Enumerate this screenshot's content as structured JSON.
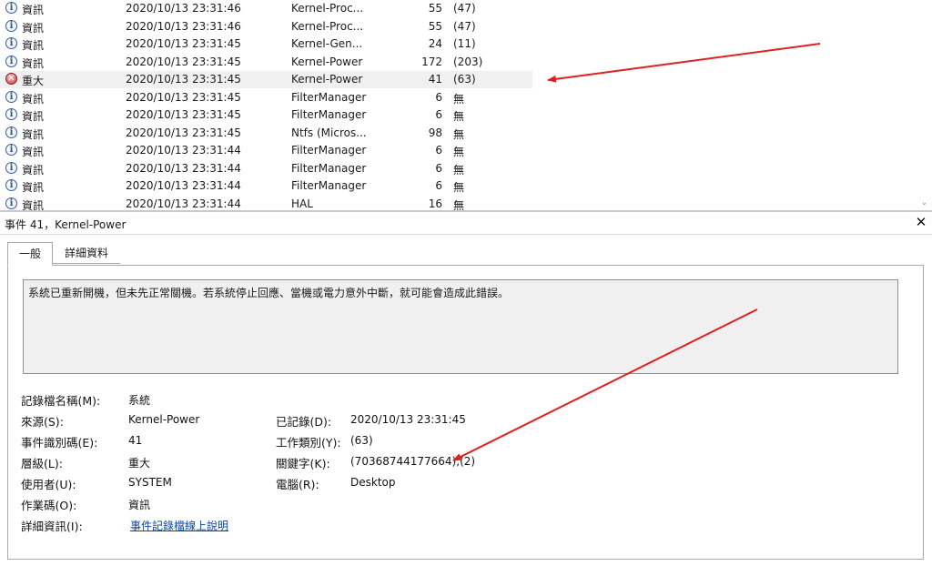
{
  "event_list": {
    "rows": [
      {
        "level": "資訊",
        "level_icon": "info-icon",
        "date": "2020/10/13 23:31:46",
        "source": "Kernel-Proc...",
        "event_id": "55",
        "task": "(47)",
        "selected": false
      },
      {
        "level": "資訊",
        "level_icon": "info-icon",
        "date": "2020/10/13 23:31:46",
        "source": "Kernel-Proc...",
        "event_id": "55",
        "task": "(47)",
        "selected": false
      },
      {
        "level": "資訊",
        "level_icon": "info-icon",
        "date": "2020/10/13 23:31:45",
        "source": "Kernel-Gen...",
        "event_id": "24",
        "task": "(11)",
        "selected": false
      },
      {
        "level": "資訊",
        "level_icon": "info-icon",
        "date": "2020/10/13 23:31:45",
        "source": "Kernel-Power",
        "event_id": "172",
        "task": "(203)",
        "selected": false
      },
      {
        "level": "重大",
        "level_icon": "critical-icon",
        "date": "2020/10/13 23:31:45",
        "source": "Kernel-Power",
        "event_id": "41",
        "task": "(63)",
        "selected": true
      },
      {
        "level": "資訊",
        "level_icon": "info-icon",
        "date": "2020/10/13 23:31:45",
        "source": "FilterManager",
        "event_id": "6",
        "task": "無",
        "selected": false
      },
      {
        "level": "資訊",
        "level_icon": "info-icon",
        "date": "2020/10/13 23:31:45",
        "source": "FilterManager",
        "event_id": "6",
        "task": "無",
        "selected": false
      },
      {
        "level": "資訊",
        "level_icon": "info-icon",
        "date": "2020/10/13 23:31:45",
        "source": "Ntfs (Micros...",
        "event_id": "98",
        "task": "無",
        "selected": false
      },
      {
        "level": "資訊",
        "level_icon": "info-icon",
        "date": "2020/10/13 23:31:44",
        "source": "FilterManager",
        "event_id": "6",
        "task": "無",
        "selected": false
      },
      {
        "level": "資訊",
        "level_icon": "info-icon",
        "date": "2020/10/13 23:31:44",
        "source": "FilterManager",
        "event_id": "6",
        "task": "無",
        "selected": false
      },
      {
        "level": "資訊",
        "level_icon": "info-icon",
        "date": "2020/10/13 23:31:44",
        "source": "FilterManager",
        "event_id": "6",
        "task": "無",
        "selected": false
      },
      {
        "level": "資訊",
        "level_icon": "info-icon",
        "date": "2020/10/13 23:31:44",
        "source": "HAL",
        "event_id": "16",
        "task": "無",
        "selected": false
      }
    ]
  },
  "detail": {
    "title": "事件 41，Kernel-Power",
    "tabs": [
      "一般",
      "詳細資料"
    ],
    "active_tab": "一般",
    "description": "系統已重新開機，但未先正常關機。若系統停止回應、當機或電力意外中斷，就可能會造成此錯誤。",
    "props": {
      "log_name": {
        "label": "記錄檔名稱(M):",
        "value": "系統"
      },
      "source": {
        "label": "來源(S):",
        "value": "Kernel-Power"
      },
      "logged": {
        "label": "已記錄(D):",
        "value": "2020/10/13 23:31:45"
      },
      "event_id": {
        "label": "事件識別碼(E):",
        "value": "41"
      },
      "task_category": {
        "label": "工作類別(Y):",
        "value": "(63)"
      },
      "level": {
        "label": "層級(L):",
        "value": "重大"
      },
      "keywords": {
        "label": "關鍵字(K):",
        "value": "(70368744177664),(2)"
      },
      "user": {
        "label": "使用者(U):",
        "value": "SYSTEM"
      },
      "computer": {
        "label": "電腦(R):",
        "value": "Desktop"
      },
      "opcode": {
        "label": "作業碼(O):",
        "value": "資訊"
      },
      "more_info": {
        "label": "詳細資訊(I):",
        "value": "事件記錄檔線上說明"
      }
    }
  },
  "colors": {
    "annotation_arrow": "#e02020",
    "link": "#0645ad",
    "selected_row": "#f0f0f0"
  }
}
